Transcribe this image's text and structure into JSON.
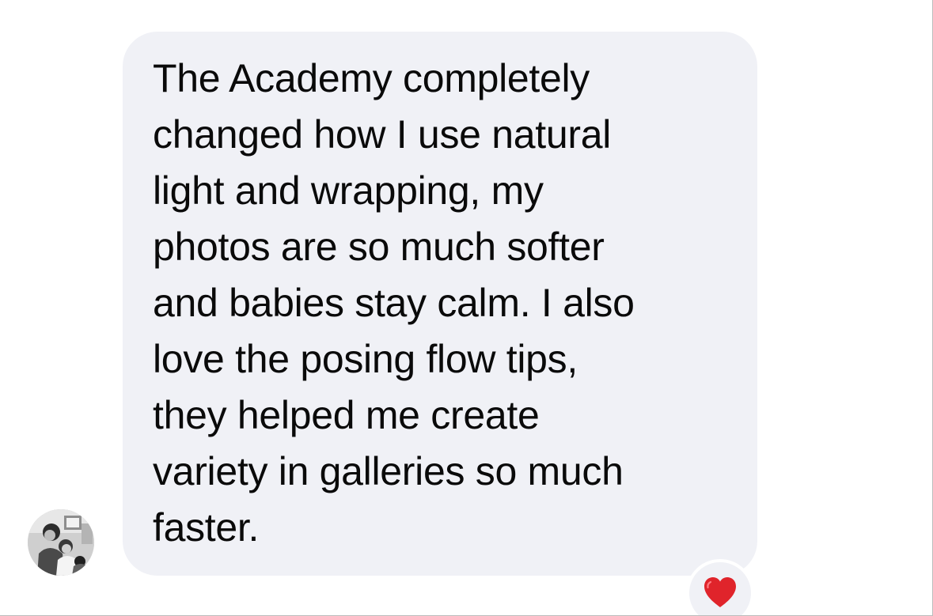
{
  "message": {
    "text": "The Academy completely\nchanged how I use natural\nlight and wrapping, my\nphotos are so much softer\nand babies stay calm. I also\nlove the posing flow tips,\nthey helped me create\nvariety in galleries so much\nfaster.",
    "bubble_color": "#f0f1f6",
    "text_color": "#0a0a0a"
  },
  "avatar": {
    "icon": "profile-photo"
  },
  "reaction": {
    "icon": "red-heart-icon",
    "color": "#e0242b"
  }
}
